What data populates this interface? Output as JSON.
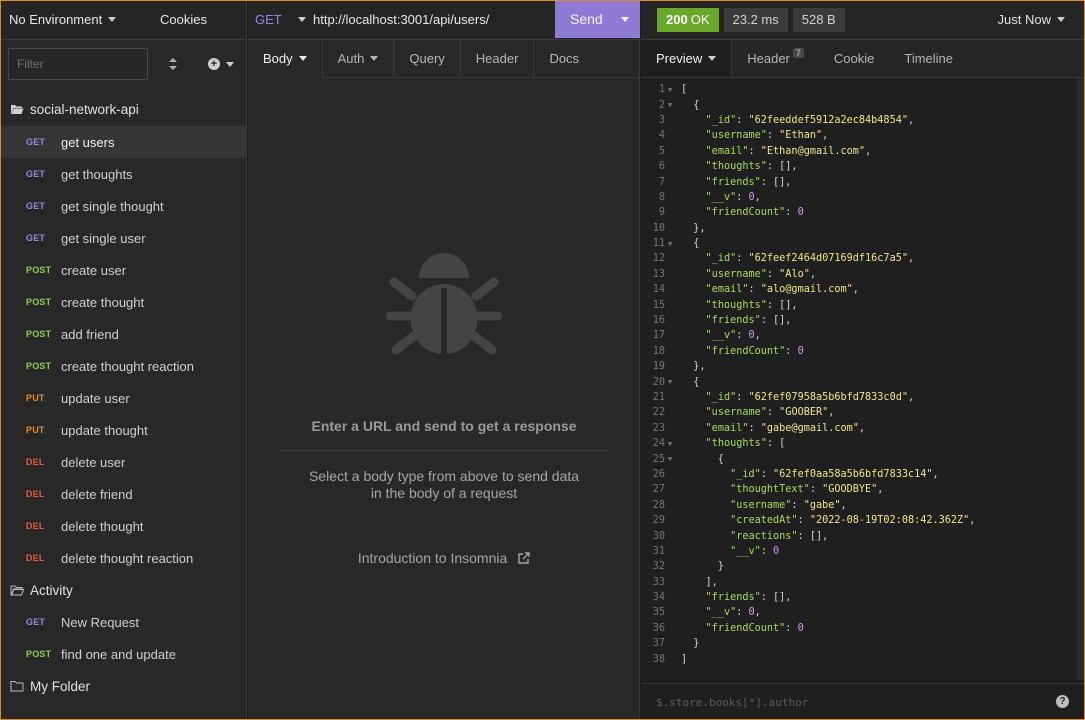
{
  "sidebar": {
    "environment": "No Environment",
    "cookies": "Cookies",
    "filter_placeholder": "Filter",
    "collection": "social-network-api",
    "requests": [
      {
        "method": "GET",
        "name": "get users",
        "active": true
      },
      {
        "method": "GET",
        "name": "get thoughts"
      },
      {
        "method": "GET",
        "name": "get single thought"
      },
      {
        "method": "GET",
        "name": "get single user"
      },
      {
        "method": "POST",
        "name": "create user"
      },
      {
        "method": "POST",
        "name": "create thought"
      },
      {
        "method": "POST",
        "name": "add friend"
      },
      {
        "method": "POST",
        "name": "create thought reaction"
      },
      {
        "method": "PUT",
        "name": "update user"
      },
      {
        "method": "PUT",
        "name": "update thought"
      },
      {
        "method": "DEL",
        "name": "delete user"
      },
      {
        "method": "DEL",
        "name": "delete friend"
      },
      {
        "method": "DEL",
        "name": "delete thought"
      },
      {
        "method": "DEL",
        "name": "delete thought reaction"
      }
    ],
    "activity_folder": "Activity",
    "activity_requests": [
      {
        "method": "GET",
        "name": "New Request"
      },
      {
        "method": "POST",
        "name": "find one and update"
      }
    ],
    "my_folder": "My Folder"
  },
  "request": {
    "method": "GET",
    "url": "http://localhost:3001/api/users/",
    "send_label": "Send",
    "tabs": [
      "Body",
      "Auth",
      "Query",
      "Header",
      "Docs"
    ],
    "empty_title": "Enter a URL and send to get a response",
    "empty_sub_1": "Select a body type from above to send data",
    "empty_sub_2": "in the body of a request",
    "intro_link": "Introduction to Insomnia"
  },
  "response": {
    "status_code": "200",
    "status_text": "OK",
    "time": "23.2 ms",
    "size": "528 B",
    "timestamp": "Just Now",
    "tabs": {
      "preview": "Preview",
      "header": "Header",
      "header_count": "7",
      "cookie": "Cookie",
      "timeline": "Timeline"
    },
    "filter_placeholder": "$.store.books[*].author",
    "help": "?",
    "body_lines": [
      [
        [
          "p",
          "["
        ]
      ],
      [
        [
          "p",
          "  {"
        ]
      ],
      [
        [
          "p",
          "    "
        ],
        [
          "k",
          "\"_id\""
        ],
        [
          "p",
          ": "
        ],
        [
          "s",
          "\"62feeddef5912a2ec84b4854\""
        ],
        [
          "p",
          ","
        ]
      ],
      [
        [
          "p",
          "    "
        ],
        [
          "k",
          "\"username\""
        ],
        [
          "p",
          ": "
        ],
        [
          "s",
          "\"Ethan\""
        ],
        [
          "p",
          ","
        ]
      ],
      [
        [
          "p",
          "    "
        ],
        [
          "k",
          "\"email\""
        ],
        [
          "p",
          ": "
        ],
        [
          "s",
          "\"Ethan@gmail.com\""
        ],
        [
          "p",
          ","
        ]
      ],
      [
        [
          "p",
          "    "
        ],
        [
          "k",
          "\"thoughts\""
        ],
        [
          "p",
          ": [],"
        ]
      ],
      [
        [
          "p",
          "    "
        ],
        [
          "k",
          "\"friends\""
        ],
        [
          "p",
          ": [],"
        ]
      ],
      [
        [
          "p",
          "    "
        ],
        [
          "k",
          "\"__v\""
        ],
        [
          "p",
          ": "
        ],
        [
          "n",
          "0"
        ],
        [
          "p",
          ","
        ]
      ],
      [
        [
          "p",
          "    "
        ],
        [
          "k",
          "\"friendCount\""
        ],
        [
          "p",
          ": "
        ],
        [
          "n",
          "0"
        ]
      ],
      [
        [
          "p",
          "  },"
        ]
      ],
      [
        [
          "p",
          "  {"
        ]
      ],
      [
        [
          "p",
          "    "
        ],
        [
          "k",
          "\"_id\""
        ],
        [
          "p",
          ": "
        ],
        [
          "s",
          "\"62feef2464d07169df16c7a5\""
        ],
        [
          "p",
          ","
        ]
      ],
      [
        [
          "p",
          "    "
        ],
        [
          "k",
          "\"username\""
        ],
        [
          "p",
          ": "
        ],
        [
          "s",
          "\"Alo\""
        ],
        [
          "p",
          ","
        ]
      ],
      [
        [
          "p",
          "    "
        ],
        [
          "k",
          "\"email\""
        ],
        [
          "p",
          ": "
        ],
        [
          "s",
          "\"alo@gmail.com\""
        ],
        [
          "p",
          ","
        ]
      ],
      [
        [
          "p",
          "    "
        ],
        [
          "k",
          "\"thoughts\""
        ],
        [
          "p",
          ": [],"
        ]
      ],
      [
        [
          "p",
          "    "
        ],
        [
          "k",
          "\"friends\""
        ],
        [
          "p",
          ": [],"
        ]
      ],
      [
        [
          "p",
          "    "
        ],
        [
          "k",
          "\"__v\""
        ],
        [
          "p",
          ": "
        ],
        [
          "n",
          "0"
        ],
        [
          "p",
          ","
        ]
      ],
      [
        [
          "p",
          "    "
        ],
        [
          "k",
          "\"friendCount\""
        ],
        [
          "p",
          ": "
        ],
        [
          "n",
          "0"
        ]
      ],
      [
        [
          "p",
          "  },"
        ]
      ],
      [
        [
          "p",
          "  {"
        ]
      ],
      [
        [
          "p",
          "    "
        ],
        [
          "k",
          "\"_id\""
        ],
        [
          "p",
          ": "
        ],
        [
          "s",
          "\"62fef07958a5b6bfd7833c0d\""
        ],
        [
          "p",
          ","
        ]
      ],
      [
        [
          "p",
          "    "
        ],
        [
          "k",
          "\"username\""
        ],
        [
          "p",
          ": "
        ],
        [
          "s",
          "\"GOOBER\""
        ],
        [
          "p",
          ","
        ]
      ],
      [
        [
          "p",
          "    "
        ],
        [
          "k",
          "\"email\""
        ],
        [
          "p",
          ": "
        ],
        [
          "s",
          "\"gabe@gmail.com\""
        ],
        [
          "p",
          ","
        ]
      ],
      [
        [
          "p",
          "    "
        ],
        [
          "k",
          "\"thoughts\""
        ],
        [
          "p",
          ": ["
        ]
      ],
      [
        [
          "p",
          "      {"
        ]
      ],
      [
        [
          "p",
          "        "
        ],
        [
          "k",
          "\"_id\""
        ],
        [
          "p",
          ": "
        ],
        [
          "s",
          "\"62fef0aa58a5b6bfd7833c14\""
        ],
        [
          "p",
          ","
        ]
      ],
      [
        [
          "p",
          "        "
        ],
        [
          "k",
          "\"thoughtText\""
        ],
        [
          "p",
          ": "
        ],
        [
          "s",
          "\"GOODBYE\""
        ],
        [
          "p",
          ","
        ]
      ],
      [
        [
          "p",
          "        "
        ],
        [
          "k",
          "\"username\""
        ],
        [
          "p",
          ": "
        ],
        [
          "s",
          "\"gabe\""
        ],
        [
          "p",
          ","
        ]
      ],
      [
        [
          "p",
          "        "
        ],
        [
          "k",
          "\"createdAt\""
        ],
        [
          "p",
          ": "
        ],
        [
          "s",
          "\"2022-08-19T02:08:42.362Z\""
        ],
        [
          "p",
          ","
        ]
      ],
      [
        [
          "p",
          "        "
        ],
        [
          "k",
          "\"reactions\""
        ],
        [
          "p",
          ": [],"
        ]
      ],
      [
        [
          "p",
          "        "
        ],
        [
          "k",
          "\"__v\""
        ],
        [
          "p",
          ": "
        ],
        [
          "n",
          "0"
        ]
      ],
      [
        [
          "p",
          "      }"
        ]
      ],
      [
        [
          "p",
          "    ],"
        ]
      ],
      [
        [
          "p",
          "    "
        ],
        [
          "k",
          "\"friends\""
        ],
        [
          "p",
          ": [],"
        ]
      ],
      [
        [
          "p",
          "    "
        ],
        [
          "k",
          "\"__v\""
        ],
        [
          "p",
          ": "
        ],
        [
          "n",
          "0"
        ],
        [
          "p",
          ","
        ]
      ],
      [
        [
          "p",
          "    "
        ],
        [
          "k",
          "\"friendCount\""
        ],
        [
          "p",
          ": "
        ],
        [
          "n",
          "0"
        ]
      ],
      [
        [
          "p",
          "  }"
        ]
      ],
      [
        [
          "p",
          "]"
        ]
      ]
    ],
    "foldable_lines": [
      1,
      2,
      11,
      20,
      24,
      25
    ]
  }
}
